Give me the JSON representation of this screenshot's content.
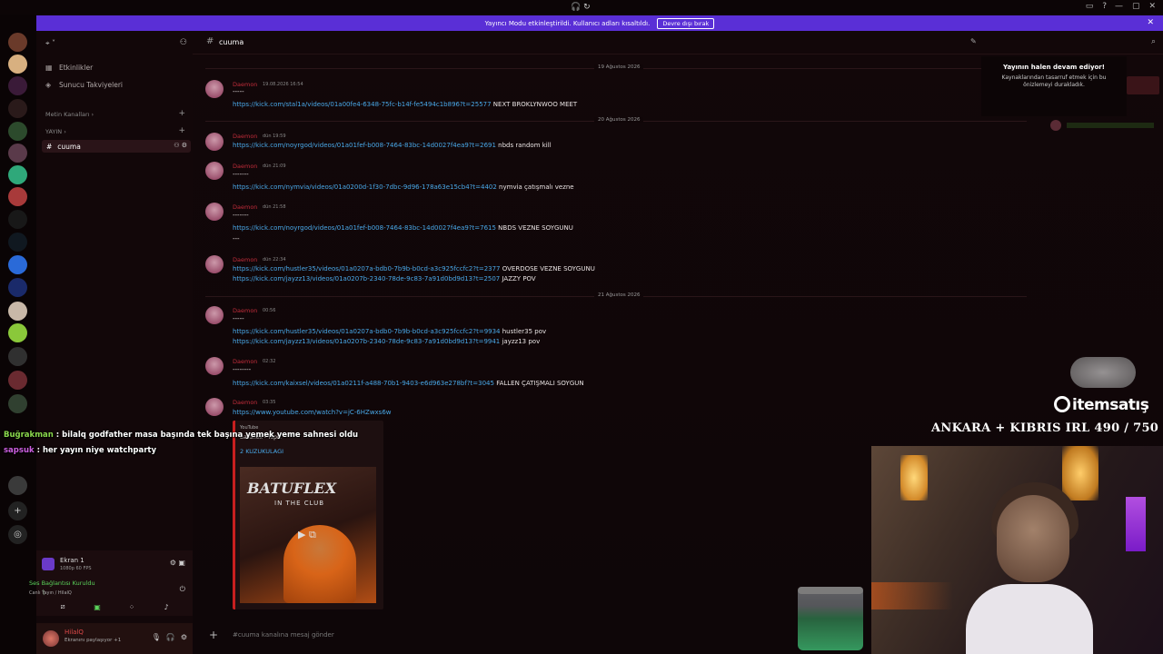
{
  "titlebar": {
    "icons": "🎧 ↻",
    "extra": [
      "▭",
      "?"
    ],
    "controls": [
      "—",
      "▢",
      "✕"
    ]
  },
  "banner": {
    "text": "Yayıncı Modu etkinleştirildi. Kullanıcı adları kısaltıldı.",
    "button": "Devre dışı bırak",
    "close": "✕"
  },
  "sidebar": {
    "header": "⌖ ˅",
    "items": [
      {
        "icon": "▦",
        "label": "Etkinlikler"
      },
      {
        "icon": "◈",
        "label": "Sunucu Takviyeleri"
      }
    ],
    "categories": [
      {
        "label": "Metin Kanalları ›"
      },
      {
        "label": "YAYIN ›"
      }
    ],
    "active_channel": "cuuma"
  },
  "ekran": {
    "title": "Ekran 1",
    "subtitle": "1080p 60 FPS"
  },
  "ses": {
    "title": "Ses Bağlantısı Kuruldu",
    "subtitle": "Canlı Yayın / HilalQ"
  },
  "user": {
    "name": "HilalQ",
    "status": "Ekranını paylaşıyor +1"
  },
  "channel": {
    "name": "cuuma",
    "placeholder": "#cuuma kanalına mesaj gönder"
  },
  "dividers": [
    "19 Ağustos 2026",
    "20 Ağustos 2026",
    "21 Ağustos 2026"
  ],
  "messages": [
    {
      "author": "Daemon",
      "time": "19.08.2026 16:54",
      "lines": [
        {
          "text": "-----"
        },
        {
          "link": "https://kick.com/stal1a/videos/01a00fe4-6348-75fc-b14f-fe5494c1b896?t=25577",
          "text": " NEXT BROKLYNWOO MEET"
        }
      ]
    },
    {
      "author": "Daemon",
      "time": "dün 19:59",
      "lines": [
        {
          "link": "https://kick.com/noyrgod/videos/01a01fef-b008-7464-83bc-14d0027f4ea9?t=2691",
          "text": " nbds random kill"
        }
      ]
    },
    {
      "author": "Daemon",
      "time": "dün 21:09",
      "lines": [
        {
          "text": "-------"
        },
        {
          "link": "https://kick.com/nymvia/videos/01a0200d-1f30-7dbc-9d96-178a63e15cb4?t=4402",
          "text": " nymvia çatışmalı vezne"
        }
      ]
    },
    {
      "author": "Daemon",
      "time": "dün 21:58",
      "lines": [
        {
          "text": "-------"
        },
        {
          "link": "https://kick.com/noyrgod/videos/01a01fef-b008-7464-83bc-14d0027f4ea9?t=7615",
          "text": " NBDS VEZNE SOYGUNU"
        },
        {
          "text": "---"
        }
      ]
    },
    {
      "author": "Daemon",
      "time": "dün 22:34",
      "lines": [
        {
          "link": "https://kick.com/hustler35/videos/01a0207a-bdb0-7b9b-b0cd-a3c925fccfc2?t=2377",
          "text": " OVERDOSE VEZNE SOYGUNU"
        },
        {
          "link": "https://kick.com/jayzz13/videos/01a0207b-2340-78de-9c83-7a91d0bd9d13?t=2507",
          "text": " JAZZY POV"
        }
      ]
    },
    {
      "author": "Daemon",
      "time": "00:56",
      "lines": [
        {
          "text": "-----"
        },
        {
          "link": "https://kick.com/hustler35/videos/01a0207a-bdb0-7b9b-b0cd-a3c925fccfc2?t=9934",
          "text": " hustler35 pov"
        },
        {
          "link": "https://kick.com/jayzz13/videos/01a0207b-2340-78de-9c83-7a91d0bd9d13?t=9941",
          "text": " jayzz13 pov"
        }
      ]
    },
    {
      "author": "Daemon",
      "time": "02:32",
      "lines": [
        {
          "text": "--------"
        },
        {
          "link": "https://kick.com/kaixsel/videos/01a0211f-a488-70b1-9403-e6d963e278bf?t=3045",
          "text": " FALLEN ÇATIŞMALI SOYGUN"
        }
      ]
    },
    {
      "author": "Daemon",
      "time": "03:35",
      "lines": [
        {
          "link": "https://www.youtube.com/watch?v=jC-6HZwxs6w",
          "text": ""
        }
      ]
    }
  ],
  "embed": {
    "provider": "YouTube",
    "author": "Batuflex - Topic",
    "title": "2 KUZUKULAGI",
    "thumb_text": "BATUFLEX",
    "thumb_sub": "IN THE CLUB"
  },
  "stream_notice": {
    "title": "Yayının halen devam ediyor!",
    "body": "Kaynaklarından tasarruf etmek için bu önizlemeyi durakladık."
  },
  "overlay": {
    "brand": "itemsatış",
    "goal": "ANKARA + KIBRIS IRL 490 / 750",
    "chat": [
      {
        "user": "Buğrakman",
        "sep": " : ",
        "text": "bilalq godfather masa başında tek başına yemek yeme sahnesi oldu"
      },
      {
        "user": "sapsuk",
        "sep": " : ",
        "text": "her yayın niye watchparty"
      }
    ]
  },
  "colors": {
    "banner": "#5a2fd6",
    "link": "#49a8e8",
    "author": "#c02c3a",
    "accent_red": "#c81f1f"
  }
}
